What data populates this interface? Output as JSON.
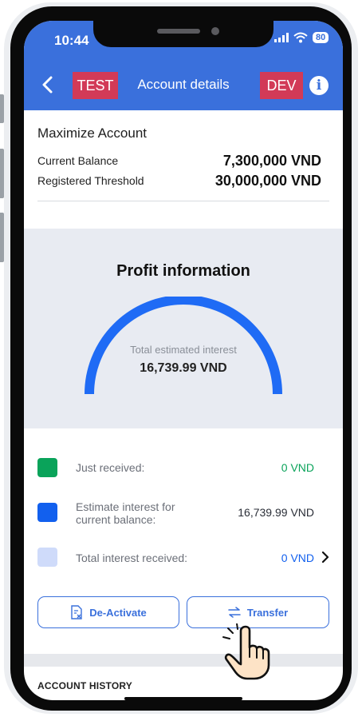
{
  "status": {
    "time": "10:44",
    "battery": "80"
  },
  "header": {
    "title": "Account details",
    "test_tag": "TEST",
    "dev_tag": "DEV"
  },
  "account": {
    "title": "Maximize Account",
    "current_balance_label": "Current Balance",
    "current_balance_value": "7,300,000 VND",
    "threshold_label": "Registered Threshold",
    "threshold_value": "30,000,000 VND"
  },
  "profit": {
    "title": "Profit information",
    "caption": "Total estimated interest",
    "value": "16,739.99 VND"
  },
  "legend": [
    {
      "label": "Just received:",
      "value": "0 VND",
      "color": "#0aa35a",
      "value_color": "#0aa35a"
    },
    {
      "label": "Estimate interest for current balance:",
      "value": "16,739.99 VND",
      "color": "#1260ee",
      "value_color": "#2b2f38"
    },
    {
      "label": "Total interest received:",
      "value": "0 VND",
      "color": "#cfdbfa",
      "value_color": "#1260ee"
    }
  ],
  "buttons": {
    "deactivate": "De-Activate",
    "transfer": "Transfer"
  },
  "history": {
    "title": "ACCOUNT HISTORY"
  },
  "colors": {
    "header_bg": "#3a70dc",
    "tag_bg": "#d23a57",
    "gauge": "#1f6bf5",
    "panel_bg": "#e8ebf2"
  }
}
